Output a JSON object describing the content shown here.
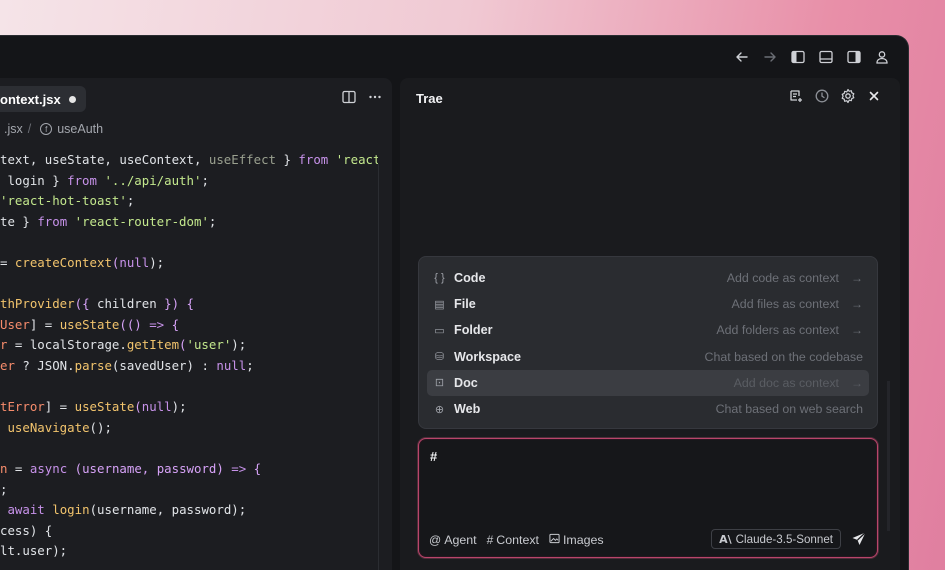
{
  "editor": {
    "tab_label": "ontext.jsx",
    "breadcrumb_file": ".jsx",
    "breadcrumb_separator": "/",
    "breadcrumb_symbol": "useAuth",
    "code_lines": [
      [
        {
          "t": "text, useState, useContext, ",
          "c": "pl"
        },
        {
          "t": "useEffect",
          "c": "dim"
        },
        {
          "t": " } ",
          "c": "pl"
        },
        {
          "t": "from",
          "c": "kw"
        },
        {
          "t": " ",
          "c": "pl"
        },
        {
          "t": "'react'",
          "c": "str"
        },
        {
          "t": ";",
          "c": "pl"
        }
      ],
      [
        {
          "t": " login } ",
          "c": "pl"
        },
        {
          "t": "from",
          "c": "kw"
        },
        {
          "t": " ",
          "c": "pl"
        },
        {
          "t": "'../api/auth'",
          "c": "str"
        },
        {
          "t": ";",
          "c": "pl"
        }
      ],
      [
        {
          "t": "'react-hot-toast'",
          "c": "str"
        },
        {
          "t": ";",
          "c": "pl"
        }
      ],
      [
        {
          "t": "te } ",
          "c": "pl"
        },
        {
          "t": "from",
          "c": "kw"
        },
        {
          "t": " ",
          "c": "pl"
        },
        {
          "t": "'react-router-dom'",
          "c": "str"
        },
        {
          "t": ";",
          "c": "pl"
        }
      ],
      [],
      [
        {
          "t": "= ",
          "c": "pl"
        },
        {
          "t": "createContext",
          "c": "fn"
        },
        {
          "t": "(",
          "c": "br"
        },
        {
          "t": "null",
          "c": "kw"
        },
        {
          "t": ");",
          "c": "pl"
        }
      ],
      [],
      [
        {
          "t": "thProvider",
          "c": "fn"
        },
        {
          "t": "({ ",
          "c": "br"
        },
        {
          "t": "children",
          "c": "pl"
        },
        {
          "t": " }) {",
          "c": "br"
        }
      ],
      [
        {
          "t": "User",
          "c": "pr"
        },
        {
          "t": "] = ",
          "c": "pl"
        },
        {
          "t": "useState",
          "c": "fn"
        },
        {
          "t": "(() ",
          "c": "br"
        },
        {
          "t": "=>",
          "c": "kw"
        },
        {
          "t": " {",
          "c": "br"
        }
      ],
      [
        {
          "t": "r",
          "c": "pr"
        },
        {
          "t": " = localStorage.",
          "c": "pl"
        },
        {
          "t": "getItem",
          "c": "fn"
        },
        {
          "t": "(",
          "c": "br"
        },
        {
          "t": "'user'",
          "c": "str"
        },
        {
          "t": ");",
          "c": "pl"
        }
      ],
      [
        {
          "t": "er",
          "c": "pr"
        },
        {
          "t": " ? JSON.",
          "c": "pl"
        },
        {
          "t": "parse",
          "c": "fn"
        },
        {
          "t": "(savedUser) : ",
          "c": "pl"
        },
        {
          "t": "null",
          "c": "kw"
        },
        {
          "t": ";",
          "c": "pl"
        }
      ],
      [],
      [
        {
          "t": "tError",
          "c": "pr"
        },
        {
          "t": "] = ",
          "c": "pl"
        },
        {
          "t": "useState",
          "c": "fn"
        },
        {
          "t": "(",
          "c": "br"
        },
        {
          "t": "null",
          "c": "kw"
        },
        {
          "t": ");",
          "c": "pl"
        }
      ],
      [
        {
          "t": " ",
          "c": "pl"
        },
        {
          "t": "useNavigate",
          "c": "fn"
        },
        {
          "t": "();",
          "c": "pl"
        }
      ],
      [],
      [
        {
          "t": "n",
          "c": "pr"
        },
        {
          "t": " = ",
          "c": "pl"
        },
        {
          "t": "async",
          "c": "kw"
        },
        {
          "t": " ",
          "c": "pl"
        },
        {
          "t": "(username, password) ",
          "c": "br"
        },
        {
          "t": "=>",
          "c": "kw"
        },
        {
          "t": " {",
          "c": "br"
        }
      ],
      [
        {
          "t": ";",
          "c": "pl"
        }
      ],
      [
        {
          "t": " ",
          "c": "pl"
        },
        {
          "t": "await",
          "c": "kw"
        },
        {
          "t": " ",
          "c": "pl"
        },
        {
          "t": "login",
          "c": "fn"
        },
        {
          "t": "(username, password);",
          "c": "pl"
        }
      ],
      [
        {
          "t": "cess) {",
          "c": "pl"
        }
      ],
      [
        {
          "t": "lt.user);",
          "c": "pl"
        }
      ]
    ]
  },
  "chat": {
    "title": "Trae",
    "menu": [
      {
        "icon": "{ }",
        "label": "Code",
        "hint": "Add code as context",
        "arrow": "→",
        "active": false
      },
      {
        "icon": "▤",
        "label": "File",
        "hint": "Add files as context",
        "arrow": "→",
        "active": false
      },
      {
        "icon": "▭",
        "label": "Folder",
        "hint": "Add folders as context",
        "arrow": "→",
        "active": false
      },
      {
        "icon": "⛁",
        "label": "Workspace",
        "hint": "Chat based on the codebase",
        "arrow": "",
        "active": false
      },
      {
        "icon": "⊡",
        "label": "Doc",
        "hint": "Add doc as context",
        "arrow": "→",
        "active": true
      },
      {
        "icon": "⊕",
        "label": "Web",
        "hint": "Chat based on web search",
        "arrow": "",
        "active": false
      }
    ],
    "input_value": "#",
    "footer": {
      "agent_label": "Agent",
      "context_label": "Context",
      "images_label": "Images",
      "model_label": "Claude-3.5-Sonnet"
    }
  }
}
